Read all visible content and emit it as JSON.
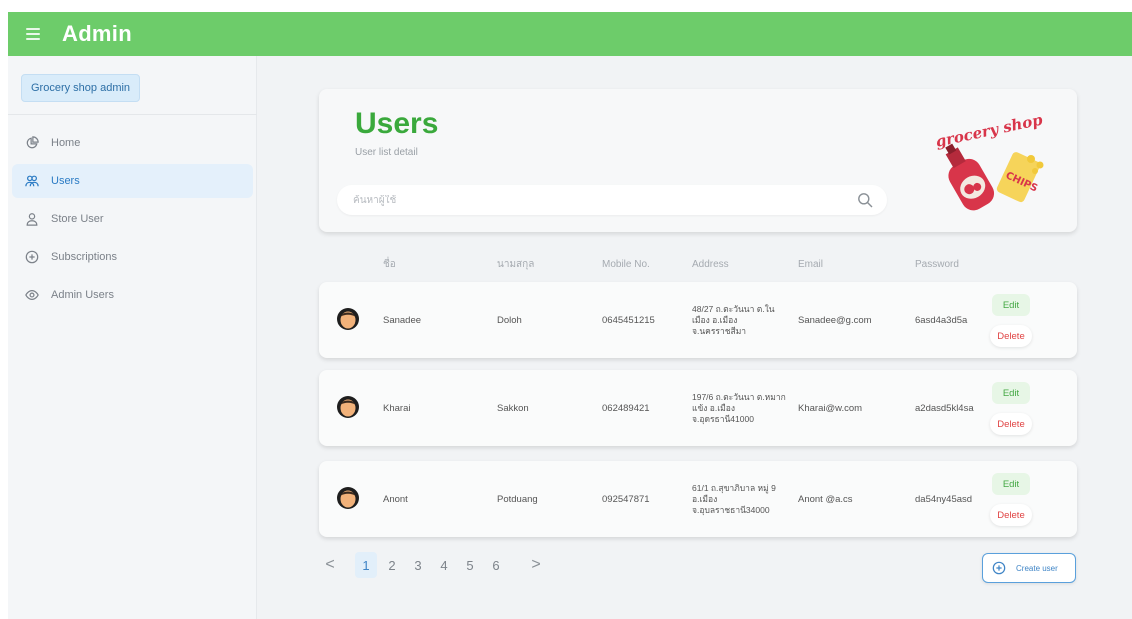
{
  "header": {
    "title": "Admin"
  },
  "sidebar": {
    "shop_label": "Grocery shop admin",
    "items": [
      {
        "label": "Home",
        "icon": "chart-pie-icon",
        "active": false
      },
      {
        "label": "Users",
        "icon": "users-icon",
        "active": true
      },
      {
        "label": "Store User",
        "icon": "user-icon",
        "active": false
      },
      {
        "label": "Subscriptions",
        "icon": "plus-circle-icon",
        "active": false
      },
      {
        "label": "Admin Users",
        "icon": "eye-icon",
        "active": false
      }
    ]
  },
  "page": {
    "title": "Users",
    "subtitle": "User list detail",
    "search_placeholder": "ค้นหาผู้ใช้",
    "logo_text": "grocery shop"
  },
  "table": {
    "headers": {
      "name": "ชื่อ",
      "last": "นามสกุล",
      "mobile": "Mobile No.",
      "address": "Address",
      "email": "Email",
      "password": "Password"
    },
    "rows": [
      {
        "name": "Sanadee",
        "last": "Doloh",
        "mobile": "0645451215",
        "address": "48/27 ถ.ตะวันนา ต.ในเมือง อ.เมือง จ.นครราชสีมา",
        "email": "Sanadee@g.com",
        "password": "6asd4a3d5a",
        "edit": "Edit",
        "delete": "Delete"
      },
      {
        "name": "Kharai",
        "last": "Sakkon",
        "mobile": "062489421",
        "address": "197/6 ถ.ตะวันนา ต.หมากแข้ง อ.เมือง จ.อุดรธานี41000",
        "email": "Kharai@w.com",
        "password": "a2dasd5kl4sa",
        "edit": "Edit",
        "delete": "Delete"
      },
      {
        "name": "Anont",
        "last": "Potduang",
        "mobile": "092547871",
        "address": "61/1 ถ.สุขาภิบาล หมู่ 9 อ.เมือง จ.อุบลราชธานี34000",
        "email": "Anont @a.cs",
        "password": "da54ny45asd",
        "edit": "Edit",
        "delete": "Delete"
      }
    ]
  },
  "pagination": {
    "prev": "<",
    "next": ">",
    "pages": [
      "1",
      "2",
      "3",
      "4",
      "5",
      "6"
    ],
    "current": "1"
  },
  "actions": {
    "create_user": "Create user"
  },
  "colors": {
    "header_green": "#6dcc6a",
    "title_green": "#3aa93c",
    "accent_blue": "#3e84c6",
    "delete_red": "#e04444"
  }
}
